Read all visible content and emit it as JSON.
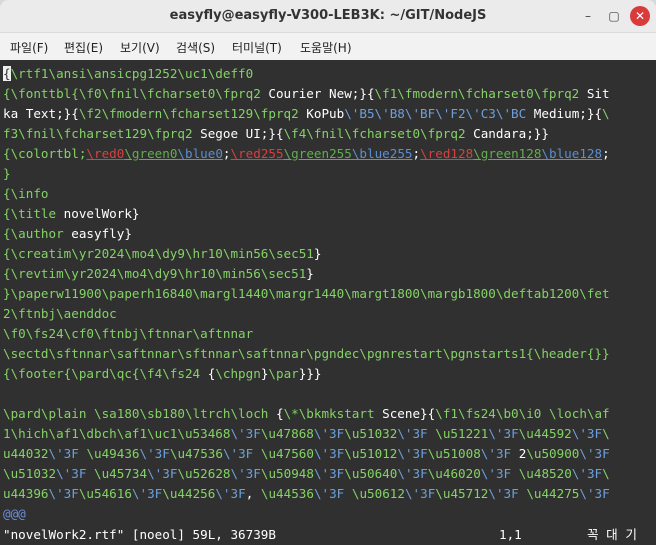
{
  "window": {
    "title": "easyfly@easyfly-V300-LEB3K: ~/GIT/NodeJS"
  },
  "menu": [
    "파일(F)",
    "편집(E)",
    "보기(V)",
    "검색(S)",
    "터미널(T)",
    "도움말(H)"
  ],
  "buttons": {
    "minimize": "–",
    "maximize": "▢",
    "close": "✕"
  },
  "lines": [
    [
      [
        "c",
        "{"
      ],
      [
        "g",
        "\\rtf1\\ansi\\ansicpg1252\\uc1\\deff0"
      ]
    ],
    [
      [
        "g",
        "{\\fonttbl{\\f0\\fnil\\fcharset0\\fprq2"
      ],
      [
        "w",
        " Courier New;}{"
      ],
      [
        "g",
        "\\f1\\fmodern\\fcharset0\\fprq2"
      ],
      [
        "w",
        " Sit"
      ]
    ],
    [
      [
        "w",
        "ka Text;}{"
      ],
      [
        "g",
        "\\f2\\fmodern\\fcharset129\\fprq2"
      ],
      [
        "w",
        " KoPub"
      ],
      [
        "b",
        "\\'B5\\'B8\\'BF\\'F2\\'C3\\'BC"
      ],
      [
        "w",
        " Medium;}{"
      ],
      [
        "g",
        "\\"
      ]
    ],
    [
      [
        "g",
        "f3\\fnil\\fcharset129\\fprq2"
      ],
      [
        "w",
        " Segoe UI;}{"
      ],
      [
        "g",
        "\\f4\\fnil\\fcharset0\\fprq2"
      ],
      [
        "w",
        " Candara;}}"
      ]
    ],
    [
      [
        "g",
        "{\\colortbl;"
      ],
      [
        "ur",
        "\\red0"
      ],
      [
        "ug",
        "\\green0"
      ],
      [
        "ub",
        "\\blue0"
      ],
      [
        "w",
        ";"
      ],
      [
        "ur",
        "\\red255"
      ],
      [
        "ug",
        "\\green255"
      ],
      [
        "ub",
        "\\blue255"
      ],
      [
        "w",
        ";"
      ],
      [
        "ur",
        "\\red128"
      ],
      [
        "ug",
        "\\green128"
      ],
      [
        "ub",
        "\\blue128"
      ],
      [
        "w",
        ";"
      ]
    ],
    [
      [
        "g",
        "}"
      ]
    ],
    [
      [
        "g",
        "{\\info"
      ]
    ],
    [
      [
        "g",
        "{\\title"
      ],
      [
        "w",
        " novelWork}"
      ]
    ],
    [
      [
        "g",
        "{\\author"
      ],
      [
        "w",
        " easyfly}"
      ]
    ],
    [
      [
        "g",
        "{\\creatim\\yr2024\\mo4\\dy9\\hr10\\min56\\sec51"
      ],
      [
        "w",
        "}"
      ]
    ],
    [
      [
        "g",
        "{\\revtim\\yr2024\\mo4\\dy9\\hr10\\min56\\sec51"
      ],
      [
        "w",
        "}"
      ]
    ],
    [
      [
        "g",
        "}\\paperw11900\\paperh16840\\margl1440\\margr1440\\margt1800\\margb1800\\deftab1200\\fet"
      ]
    ],
    [
      [
        "g",
        "2\\ftnbj\\aenddoc"
      ]
    ],
    [
      [
        "g",
        "\\f0\\fs24\\cf0\\ftnbj\\ftnnar\\aftnnar"
      ]
    ],
    [
      [
        "g",
        "\\sectd\\sftnnar\\saftnnar\\sftnnar\\saftnnar\\pgndec\\pgnrestart\\pgnstarts1{\\header{}}"
      ]
    ],
    [
      [
        "g",
        "{\\footer{\\pard\\qc{\\f4\\fs24"
      ],
      [
        "w",
        " {"
      ],
      [
        "g",
        "\\chpgn"
      ],
      [
        "w",
        "}"
      ],
      [
        "g",
        "\\par"
      ],
      [
        "w",
        "}}}"
      ]
    ],
    [
      [
        "w",
        ""
      ]
    ],
    [
      [
        "g",
        "\\pard\\plain"
      ],
      [
        "w",
        " "
      ],
      [
        "g",
        "\\sa180\\sb180\\ltrch\\loch"
      ],
      [
        "w",
        " {"
      ],
      [
        "g",
        "\\*\\bkmkstart"
      ],
      [
        "w",
        " Scene}{"
      ],
      [
        "g",
        "\\f1\\fs24\\b0\\i0"
      ],
      [
        "w",
        " "
      ],
      [
        "g",
        "\\loch\\af"
      ]
    ],
    [
      [
        "g",
        "1\\hich\\af1\\dbch\\af1\\uc1\\u53468"
      ],
      [
        "b",
        "\\'3F"
      ],
      [
        "g",
        "\\u47868"
      ],
      [
        "b",
        "\\'3F"
      ],
      [
        "g",
        "\\u51032"
      ],
      [
        "b",
        "\\'3F"
      ],
      [
        "w",
        " "
      ],
      [
        "g",
        "\\u51221"
      ],
      [
        "b",
        "\\'3F"
      ],
      [
        "g",
        "\\u44592"
      ],
      [
        "b",
        "\\'3F"
      ],
      [
        "g",
        "\\"
      ]
    ],
    [
      [
        "g",
        "u44032"
      ],
      [
        "b",
        "\\'3F"
      ],
      [
        "w",
        " "
      ],
      [
        "g",
        "\\u49436"
      ],
      [
        "b",
        "\\'3F"
      ],
      [
        "g",
        "\\u47536"
      ],
      [
        "b",
        "\\'3F"
      ],
      [
        "w",
        " "
      ],
      [
        "g",
        "\\u47560"
      ],
      [
        "b",
        "\\'3F"
      ],
      [
        "g",
        "\\u51012"
      ],
      [
        "b",
        "\\'3F"
      ],
      [
        "g",
        "\\u51008"
      ],
      [
        "b",
        "\\'3F"
      ],
      [
        "w",
        " 2"
      ],
      [
        "g",
        "\\u50900"
      ],
      [
        "b",
        "\\'3F"
      ]
    ],
    [
      [
        "g",
        "\\u51032"
      ],
      [
        "b",
        "\\'3F"
      ],
      [
        "w",
        " "
      ],
      [
        "g",
        "\\u45734"
      ],
      [
        "b",
        "\\'3F"
      ],
      [
        "g",
        "\\u52628"
      ],
      [
        "b",
        "\\'3F"
      ],
      [
        "g",
        "\\u50948"
      ],
      [
        "b",
        "\\'3F"
      ],
      [
        "g",
        "\\u50640"
      ],
      [
        "b",
        "\\'3F"
      ],
      [
        "g",
        "\\u46020"
      ],
      [
        "b",
        "\\'3F"
      ],
      [
        "w",
        " "
      ],
      [
        "g",
        "\\u48520"
      ],
      [
        "b",
        "\\'3F"
      ],
      [
        "g",
        "\\"
      ]
    ],
    [
      [
        "g",
        "u44396"
      ],
      [
        "b",
        "\\'3F"
      ],
      [
        "g",
        "\\u54616"
      ],
      [
        "b",
        "\\'3F"
      ],
      [
        "g",
        "\\u44256"
      ],
      [
        "b",
        "\\'3F"
      ],
      [
        "w",
        ", "
      ],
      [
        "g",
        "\\u44536"
      ],
      [
        "b",
        "\\'3F"
      ],
      [
        "w",
        " "
      ],
      [
        "g",
        "\\u50612"
      ],
      [
        "b",
        "\\'3F"
      ],
      [
        "g",
        "\\u45712"
      ],
      [
        "b",
        "\\'3F"
      ],
      [
        "w",
        " "
      ],
      [
        "g",
        "\\u44275"
      ],
      [
        "b",
        "\\'3F"
      ]
    ],
    [
      [
        "t",
        "@@@"
      ]
    ]
  ],
  "status": {
    "file": "\"novelWork2.rtf\" [noeol] 59L, 36739B",
    "position": "1,1",
    "view": "꼭 대 기"
  }
}
